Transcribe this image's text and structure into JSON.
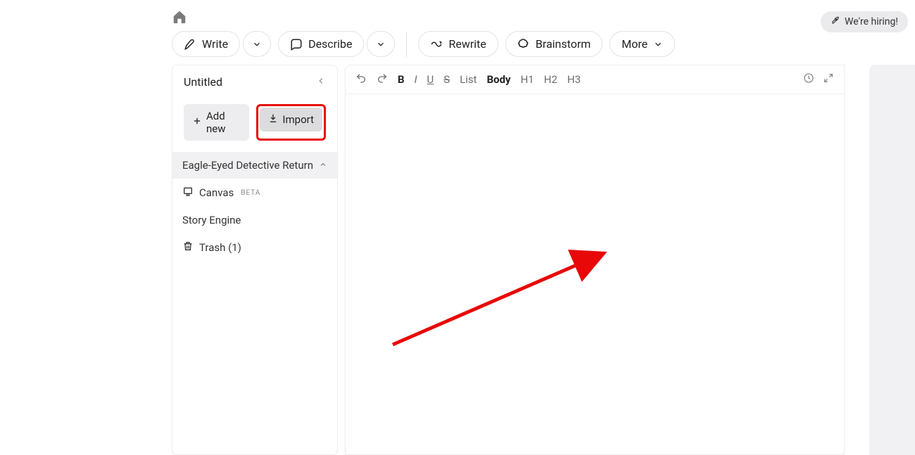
{
  "header": {
    "hiring_label": "We're hiring!"
  },
  "toolbar": {
    "write_label": "Write",
    "describe_label": "Describe",
    "rewrite_label": "Rewrite",
    "brainstorm_label": "Brainstorm",
    "more_label": "More"
  },
  "sidebar": {
    "title": "Untitled",
    "add_new_label": "Add new",
    "import_label": "Import",
    "items": {
      "chapter_title": "Eagle-Eyed Detective Returns",
      "canvas_label": "Canvas",
      "canvas_badge": "BETA",
      "story_engine_label": "Story Engine",
      "trash_label": "Trash (1)"
    }
  },
  "format_bar": {
    "bold_label": "B",
    "italic_label": "I",
    "underline_label": "U",
    "strike_label": "S",
    "list_label": "List",
    "body_label": "Body",
    "h1_label": "H1",
    "h2_label": "H2",
    "h3_label": "H3"
  }
}
